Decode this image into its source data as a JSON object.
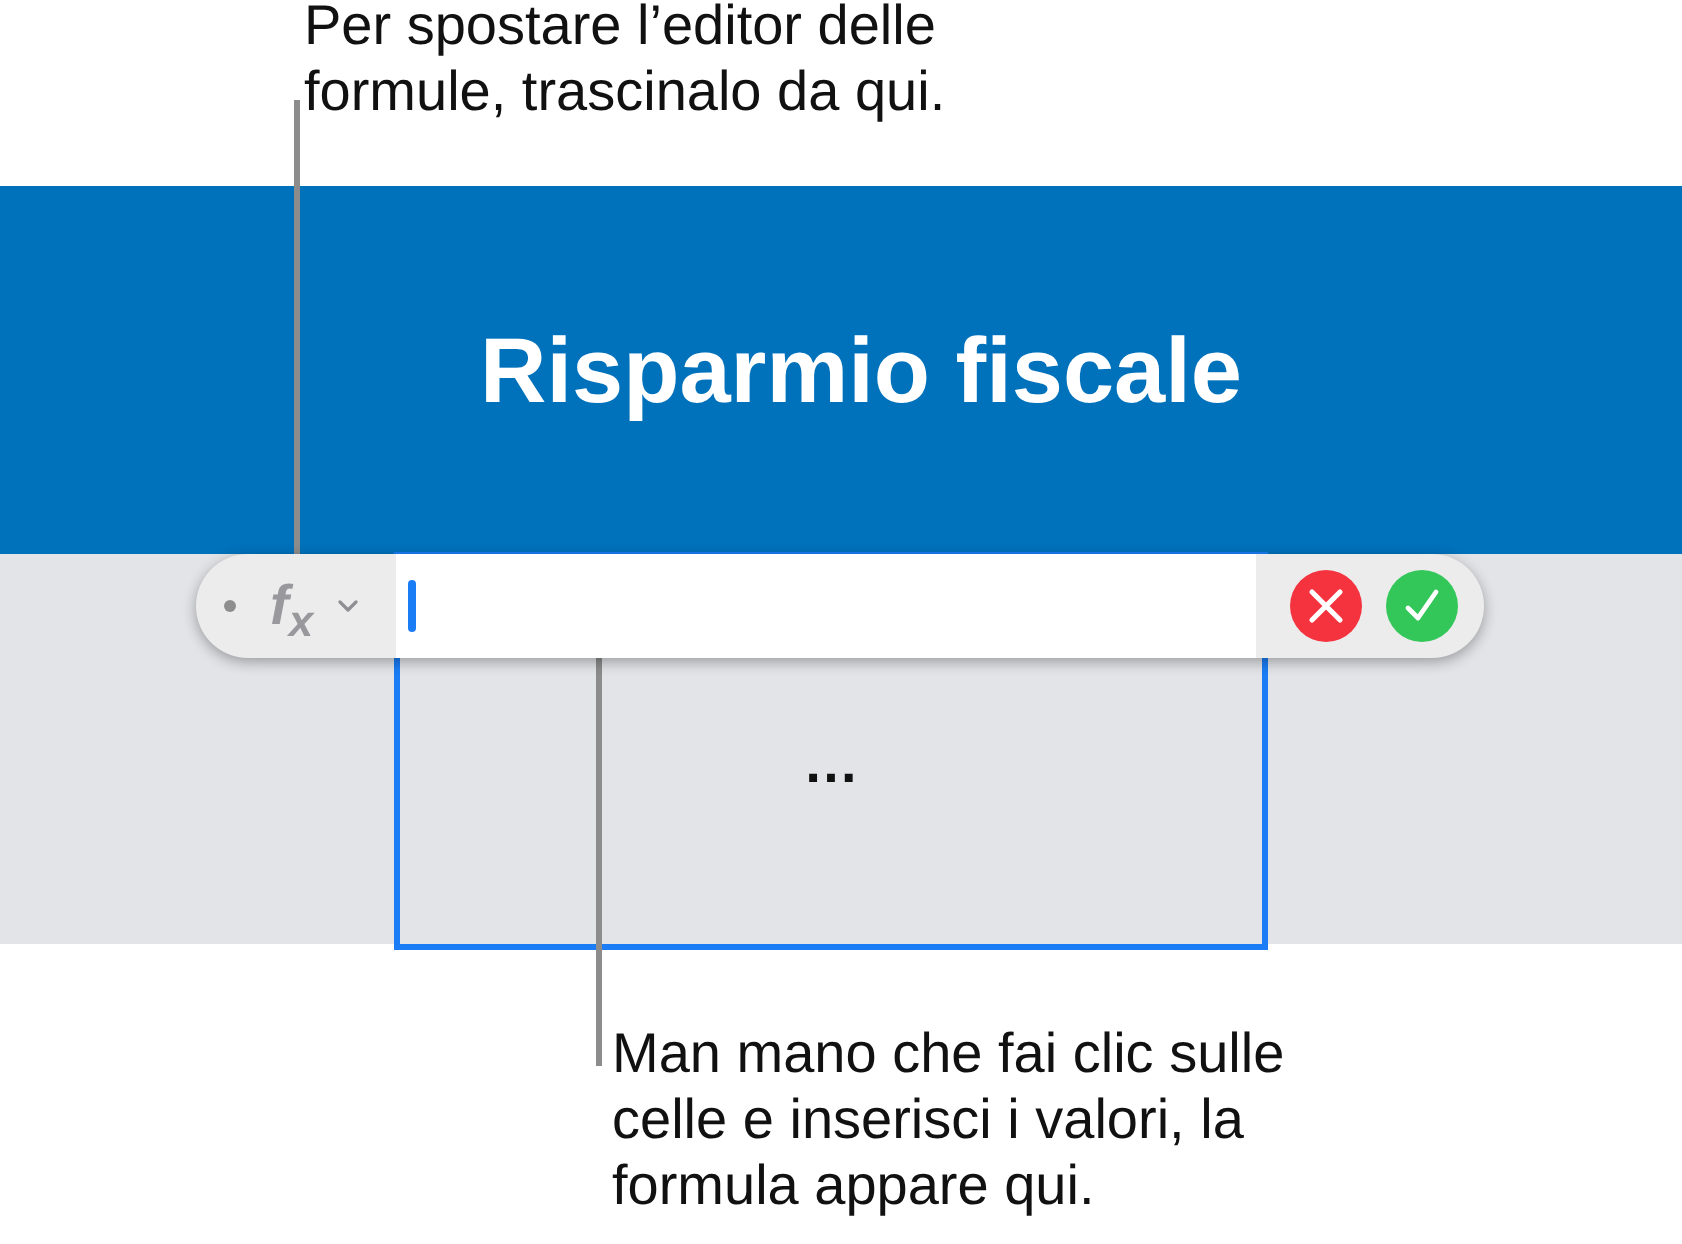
{
  "top_callout": {
    "text": "Per spostare l’editor delle formule, trascinalo da qui."
  },
  "banner": {
    "title": "Risparmio fiscale"
  },
  "formula_bar": {
    "function_label": "f$_{x}$"
  },
  "table": {
    "cell": {
      "text": "…",
      "selected": true
    }
  },
  "bottom_callout": {
    "text": "Man mano che fai clic sulle celle e inserisci i valori, la formula appare qui."
  }
}
